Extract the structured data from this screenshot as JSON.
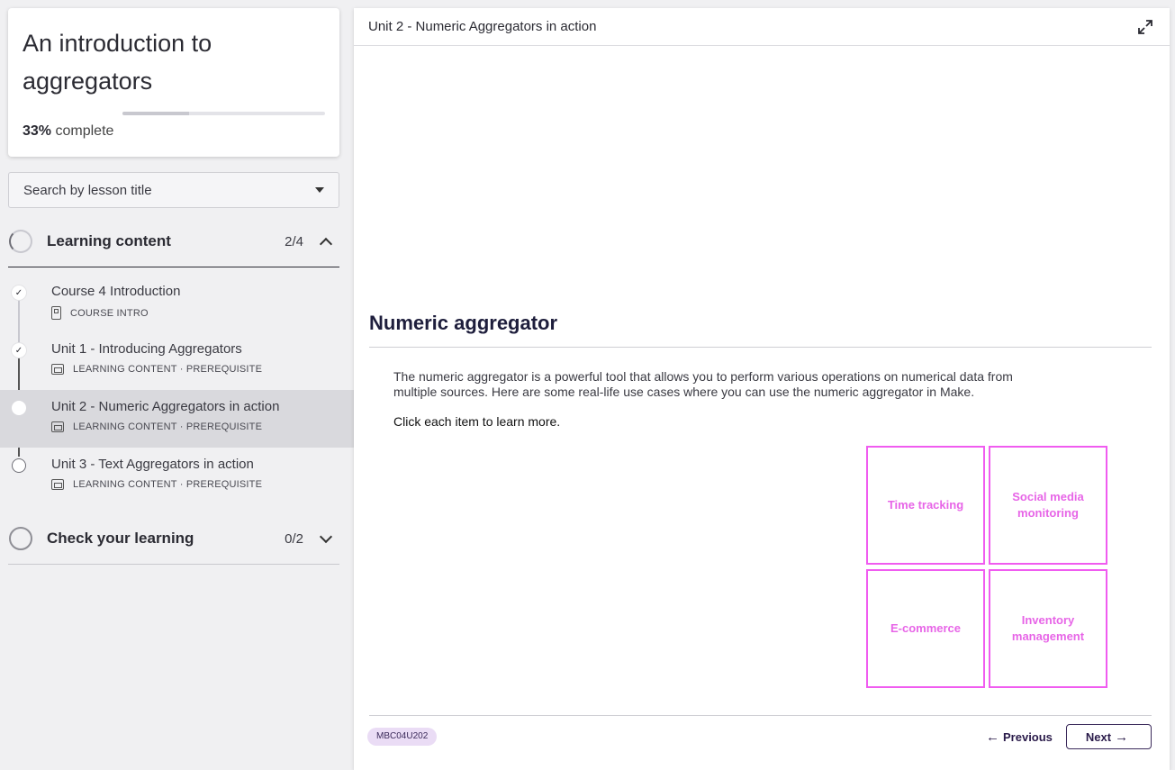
{
  "course": {
    "title": "An introduction to aggregators",
    "progress_percent": 33,
    "progress_pct_label": "33%",
    "progress_suffix": "complete"
  },
  "search": {
    "label": "Search by lesson title"
  },
  "sections": [
    {
      "title": "Learning content",
      "count": "2/4",
      "expanded": true
    },
    {
      "title": "Check your learning",
      "count": "0/2",
      "expanded": false
    }
  ],
  "lessons": [
    {
      "name": "Course 4 Introduction",
      "type": "COURSE INTRO",
      "status": "done"
    },
    {
      "name": "Unit 1 - Introducing Aggregators",
      "type": "LEARNING CONTENT · PREREQUISITE",
      "status": "done"
    },
    {
      "name": "Unit 2 - Numeric Aggregators in action",
      "type": "LEARNING CONTENT · PREREQUISITE",
      "status": "active"
    },
    {
      "name": "Unit 3 - Text Aggregators in action",
      "type": "LEARNING CONTENT · PREREQUISITE",
      "status": "todo"
    }
  ],
  "main": {
    "header_title": "Unit 2 - Numeric Aggregators in action",
    "lesson_title": "Numeric aggregator",
    "body": "The numeric aggregator is a powerful tool that allows you to perform various operations on numerical data from multiple sources. Here are some real-life use cases where you can use the numeric aggregator in Make.",
    "cta": "Click each item to learn more.",
    "cards": [
      "Time tracking",
      "Social media monitoring",
      "E-commerce",
      "Inventory management"
    ],
    "code": "MBC04U202",
    "prev_label": "Previous",
    "next_label": "Next"
  },
  "colors": {
    "accent_pink": "#f05cf0",
    "brand_purple": "#3b2a5a"
  }
}
